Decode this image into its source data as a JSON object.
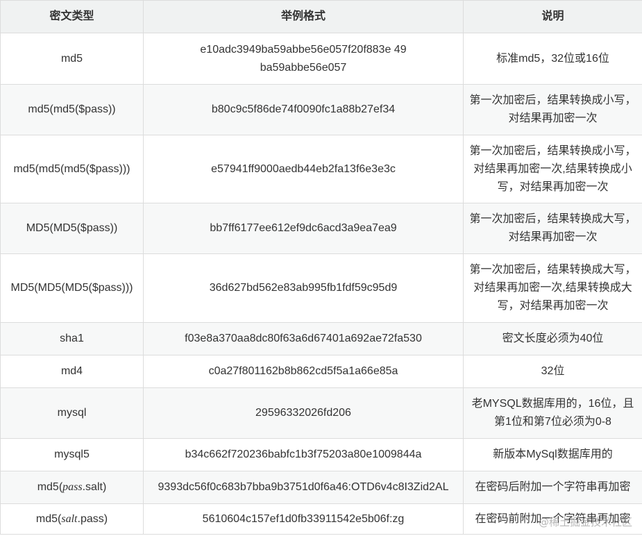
{
  "headers": [
    "密文类型",
    "举例格式",
    "说明"
  ],
  "rows": [
    {
      "type": "md5",
      "example": "e10adc3949ba59abbe56e057f20f883e 49ba59abbe56e057",
      "desc": "标准md5，32位或16位"
    },
    {
      "type": "md5(md5($pass))",
      "example": "b80c9c5f86de74f0090fc1a88b27ef34",
      "desc": "第一次加密后，结果转换成小写，对结果再加密一次"
    },
    {
      "type": "md5(md5(md5($pass)))",
      "example": "e57941ff9000aedb44eb2fa13f6e3e3c",
      "desc": "第一次加密后，结果转换成小写，对结果再加密一次,结果转换成小写，对结果再加密一次"
    },
    {
      "type": "MD5(MD5($pass))",
      "example": "bb7ff6177ee612ef9dc6acd3a9ea7ea9",
      "desc": "第一次加密后，结果转换成大写，对结果再加密一次"
    },
    {
      "type": "MD5(MD5(MD5($pass)))",
      "example": "36d627bd562e83ab995fb1fdf59c95d9",
      "desc": "第一次加密后，结果转换成大写，对结果再加密一次,结果转换成大写，对结果再加密一次"
    },
    {
      "type": "sha1",
      "example": "f03e8a370aa8dc80f63a6d67401a692ae72fa530",
      "desc": "密文长度必须为40位"
    },
    {
      "type": "md4",
      "example": "c0a27f801162b8b862cd5f5a1a66e85a",
      "desc": "32位"
    },
    {
      "type": "mysql",
      "example": "29596332026fd206",
      "desc": "老MYSQL数据库用的，16位，且第1位和第7位必须为0-8"
    },
    {
      "type": "mysql5",
      "example": "b34c662f720236babfc1b3f75203a80e1009844a",
      "desc": "新版本MySql数据库用的"
    },
    {
      "type_prefix": "md5(",
      "type_var": "pass",
      "type_suffix": ".salt)",
      "example": "9393dc56f0c683b7bba9b3751d0f6a46:OTD6v4c8I3Zid2AL",
      "desc": "在密码后附加一个字符串再加密"
    },
    {
      "type_prefix": "md5(",
      "type_var": "salt",
      "type_suffix": ".pass)",
      "example": "5610604c157ef1d0fb33911542e5b06f:zg",
      "desc": "在密码前附加一个字符串再加密"
    }
  ],
  "watermark": "@稀土掘金技术社区"
}
